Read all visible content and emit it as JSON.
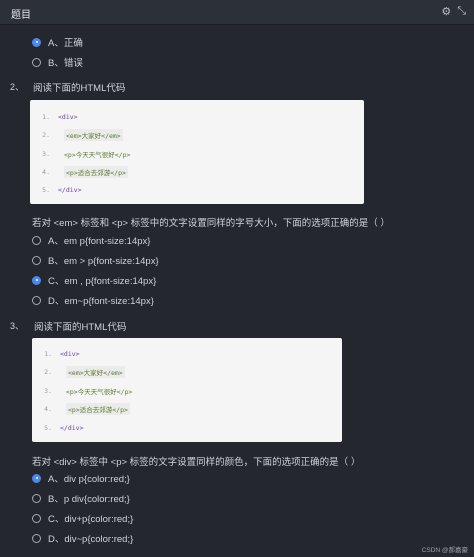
{
  "titlebar": {
    "title": "题目",
    "icons": [
      "settings-icon",
      "collapse-icon"
    ]
  },
  "q1": {
    "options": [
      {
        "label": "A、正确",
        "checked": true
      },
      {
        "label": "B、错误",
        "checked": false
      }
    ]
  },
  "q2": {
    "number": "2、",
    "prompt": "阅读下面的HTML代码",
    "code": [
      {
        "n": "1.",
        "text": "<div>"
      },
      {
        "n": "2.",
        "text": "<em>大家好</em>"
      },
      {
        "n": "3.",
        "text": "<p>今天天气很好</p>"
      },
      {
        "n": "4.",
        "text": "<p>适合去郊游</p>"
      },
      {
        "n": "5.",
        "text": "</div>"
      }
    ],
    "question": "若对 <em> 标签和 <p> 标签中的文字设置同样的字号大小，下面的选项正确的是（      ）",
    "options": [
      {
        "label": "A、em  p{font-size:14px}",
        "checked": false
      },
      {
        "label": "B、em > p{font-size:14px}",
        "checked": false
      },
      {
        "label": "C、em , p{font-size:14px}",
        "checked": true
      },
      {
        "label": "D、em~p{font-size:14px}",
        "checked": false
      }
    ]
  },
  "q3": {
    "number": "3、",
    "prompt": "阅读下面的HTML代码",
    "code": [
      {
        "n": "1.",
        "text": "<div>"
      },
      {
        "n": "2.",
        "text": "<em>大家好</em>"
      },
      {
        "n": "3.",
        "text": "<p>今天天气很好</p>"
      },
      {
        "n": "4.",
        "text": "<p>适合去郊游</p>"
      },
      {
        "n": "5.",
        "text": "</div>"
      }
    ],
    "question": "若对 <div> 标签中 <p> 标签的文字设置同样的颜色，下面的选项正确的是（      ）",
    "options": [
      {
        "label": "A、div p{color:red;}",
        "checked": true
      },
      {
        "label": "B、p div{color:red;}",
        "checked": false
      },
      {
        "label": "C、div+p{color:red;}",
        "checked": false
      },
      {
        "label": "D、div~p{color:red;}",
        "checked": false
      }
    ]
  },
  "footer": "CSDN @郝嘉豪",
  "colors": {
    "background": "#24282e",
    "accent": "#4a88f0",
    "code_bg": "#f5f5f5"
  }
}
